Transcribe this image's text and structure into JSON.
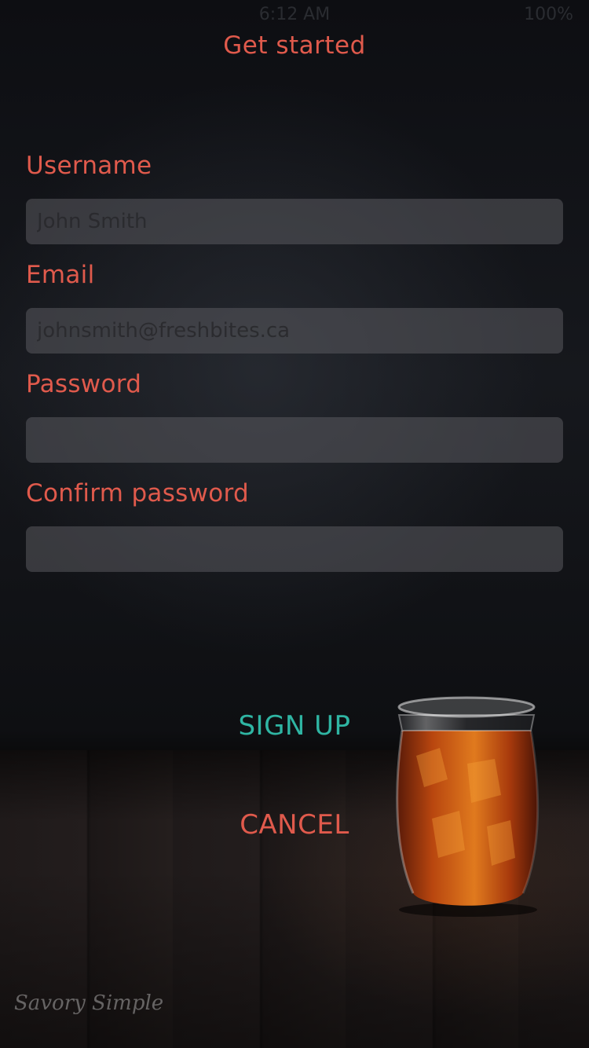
{
  "status_bar": {
    "time": "6:12 AM",
    "battery": "100%"
  },
  "header": {
    "title": "Get started"
  },
  "form": {
    "username": {
      "label": "Username",
      "placeholder": "John Smith",
      "value": ""
    },
    "email": {
      "label": "Email",
      "placeholder": "johnsmith@freshbites.ca",
      "value": ""
    },
    "password": {
      "label": "Password",
      "placeholder": "",
      "value": ""
    },
    "confirm_password": {
      "label": "Confirm password",
      "placeholder": "",
      "value": ""
    }
  },
  "actions": {
    "sign_up_label": "SIGN UP",
    "cancel_label": "CANCEL"
  },
  "background": {
    "watermark": "Savory Simple"
  },
  "colors": {
    "accent_red": "#e05a4c",
    "accent_teal": "#2fb5a3",
    "input_bg": "#4a4b50"
  }
}
